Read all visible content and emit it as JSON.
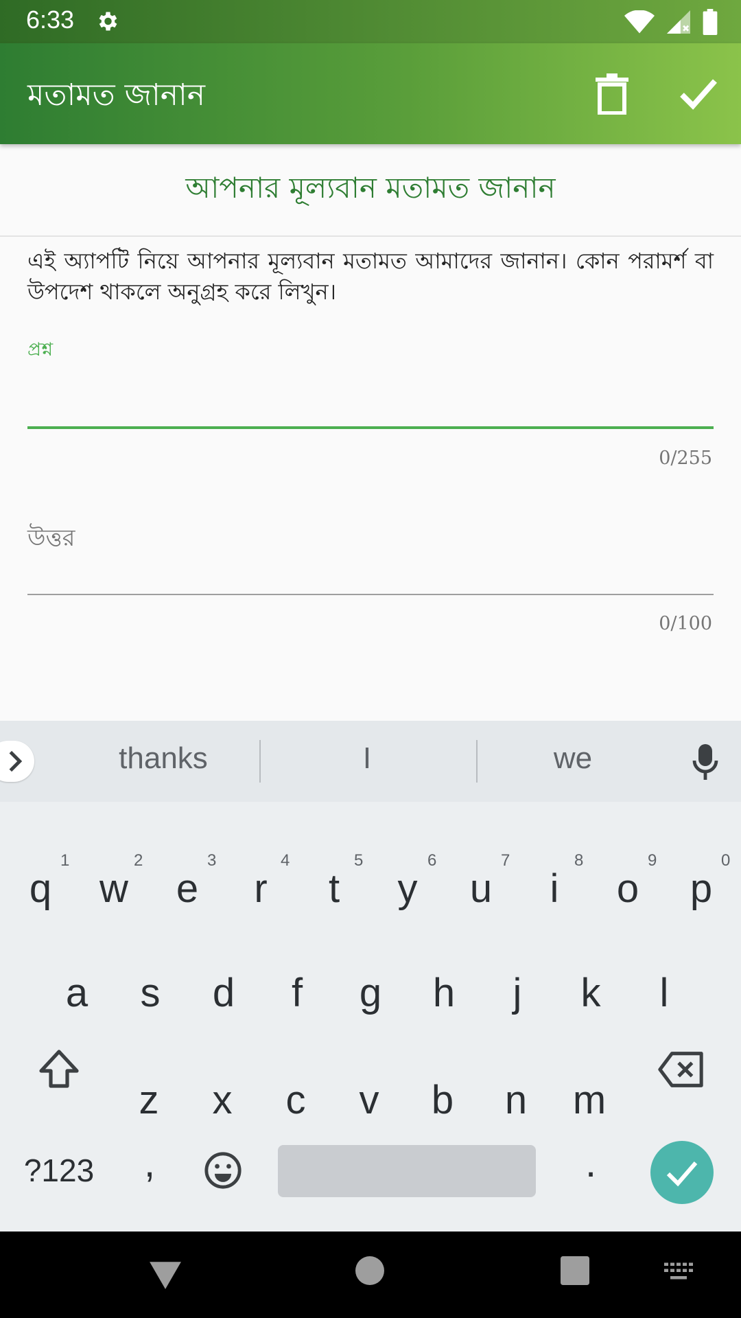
{
  "status_bar": {
    "time": "6:33"
  },
  "app_bar": {
    "title": "মতামত জানান"
  },
  "form": {
    "header": "আপনার মূল্যবান মতামত জানান",
    "intro": "এই অ্যাপটি নিয়ে আপনার মূল্যবান মতামত আমাদের জানান। কোন পরামর্শ বা উপদেশ থাকলে অনুগ্রহ করে লিখুন।",
    "question_label": "প্রশ্ন",
    "question_counter": "0/255",
    "answer_label": "উত্তর",
    "answer_counter": "0/100"
  },
  "keyboard": {
    "suggestions": [
      "thanks",
      "I",
      "we"
    ],
    "row1": [
      "q",
      "w",
      "e",
      "r",
      "t",
      "y",
      "u",
      "i",
      "o",
      "p"
    ],
    "row1_hints": [
      "1",
      "2",
      "3",
      "4",
      "5",
      "6",
      "7",
      "8",
      "9",
      "0"
    ],
    "row2": [
      "a",
      "s",
      "d",
      "f",
      "g",
      "h",
      "j",
      "k",
      "l"
    ],
    "row3": [
      "z",
      "x",
      "c",
      "v",
      "b",
      "n",
      "m"
    ],
    "symbols_label": "?123",
    "comma": ",",
    "period": ".",
    "accent": "#4db6ac"
  },
  "colors": {
    "primary": "#2e7d32",
    "accent_green": "#4caf50"
  }
}
